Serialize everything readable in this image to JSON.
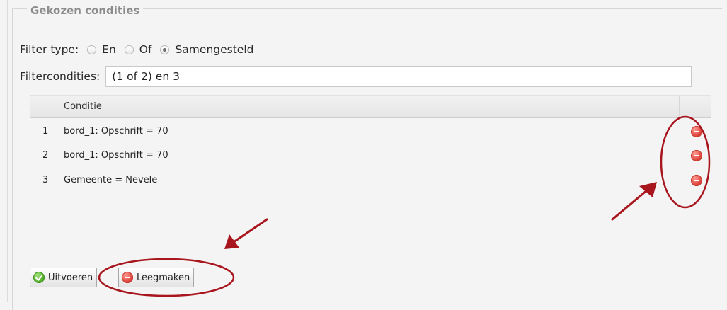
{
  "panel": {
    "legend": "Gekozen condities"
  },
  "filter_type": {
    "label": "Filter type:",
    "options": [
      {
        "label": "En",
        "checked": false
      },
      {
        "label": "Of",
        "checked": false
      },
      {
        "label": "Samengesteld",
        "checked": true
      }
    ]
  },
  "filter_conditions": {
    "label": "Filtercondities:",
    "value": "(1 of 2) en 3"
  },
  "grid": {
    "column_header": "Conditie",
    "rows": [
      {
        "num": "1",
        "condition": "bord_1: Opschrift = 70",
        "delete_icon": "minus-circle-icon"
      },
      {
        "num": "2",
        "condition": "bord_1: Opschrift = 70",
        "delete_icon": "minus-circle-icon"
      },
      {
        "num": "3",
        "condition": "Gemeente = Nevele",
        "delete_icon": "minus-circle-icon"
      }
    ]
  },
  "buttons": {
    "execute": {
      "label": "Uitvoeren",
      "icon": "check-circle-icon"
    },
    "clear": {
      "label": "Leegmaken",
      "icon": "minus-circle-icon"
    }
  },
  "colors": {
    "annotation_red": "#a8151d",
    "delete_red": "#e0463d",
    "ok_green": "#55b22d"
  }
}
